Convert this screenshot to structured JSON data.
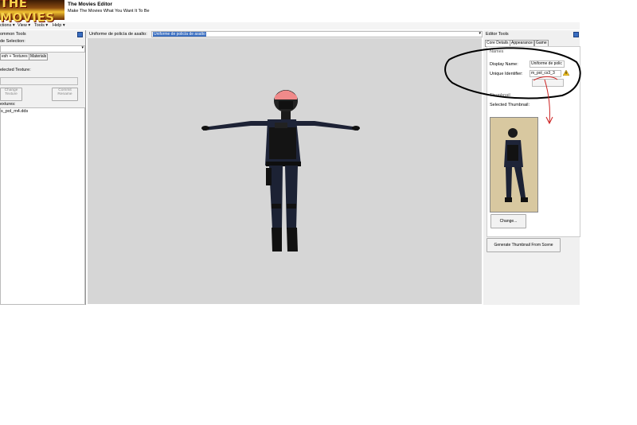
{
  "header": {
    "logo_text": "THE MOVIES",
    "title": "The Movies Editor",
    "subtitle": "Make The Movies What You Want It To Be"
  },
  "menu": {
    "items": [
      "ctions ▾",
      "View ▾",
      "Tools ▾",
      "Help ▾"
    ]
  },
  "left_panel": {
    "title": "ommon Tools",
    "selection_label": "de Selection:",
    "tabs": [
      "esh + Textures",
      "Materials"
    ],
    "selected_texture_label": "elected Texture:",
    "change_texture": [
      "Change",
      "Texture"
    ],
    "commit_rename": [
      "Commit",
      "Rename"
    ],
    "textures_label": "extures:",
    "texture_file": "s_pol_m4.dds"
  },
  "center": {
    "object_label": "Uniforme de policía de asalto:",
    "object_value": "Uniforme de policía de asalto"
  },
  "right_panel": {
    "title": "Editor Tools",
    "tabs": [
      "Core Details",
      "Appearance",
      "Game"
    ],
    "section_label": "Names",
    "display_name_label": "Display Name:",
    "display_name_value": "Uniforme de polic",
    "unique_id_label": "Unique Identifier:",
    "unique_id_value": "m_pol_cs3_3",
    "thumbnail_label": "Thumbnail",
    "selected_thumbnail_label": "Selected Thumbnail:",
    "change_button": "Change...",
    "generate_button": "Generate Thumbnail  From Scene"
  },
  "colors": {
    "viewport": "#d6d6d6",
    "selection": "#3a6ec0",
    "annotation_black": "#000000",
    "annotation_red": "#cc2020"
  }
}
